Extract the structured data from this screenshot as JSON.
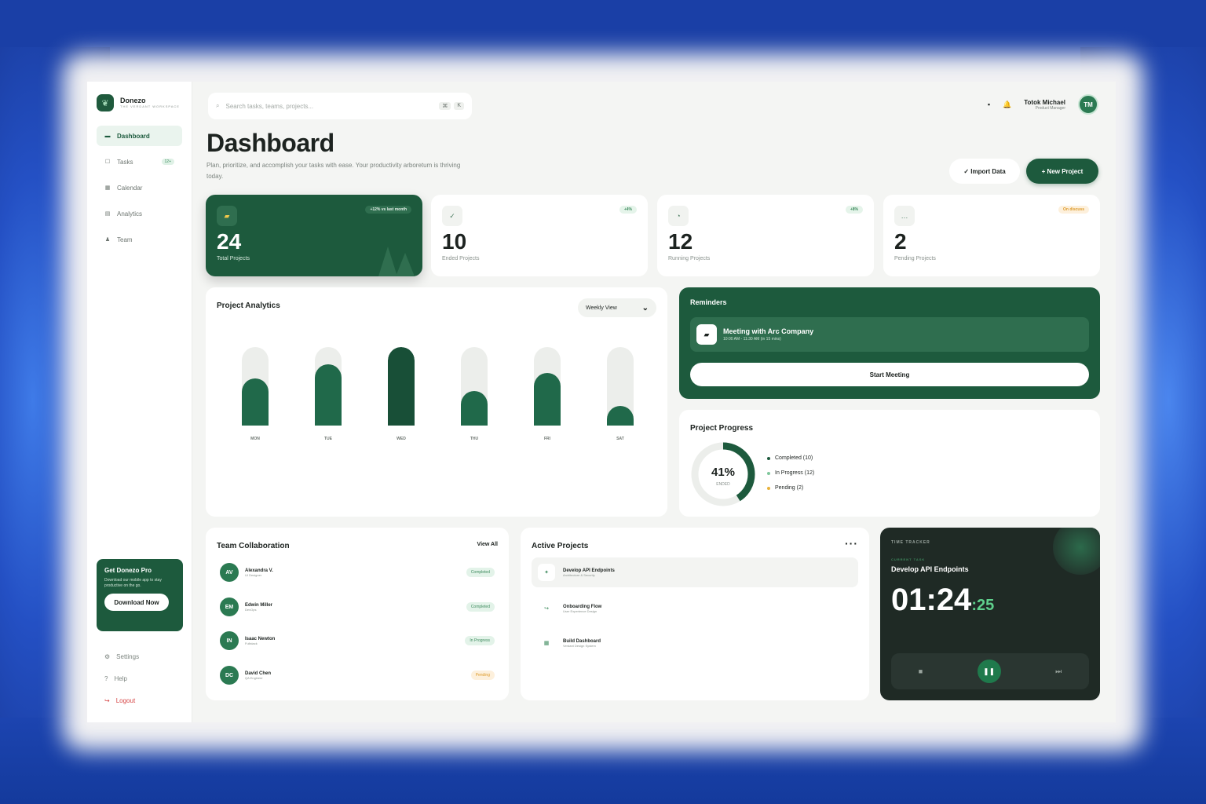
{
  "app": {
    "name": "Donezo",
    "subtitle": "THE VERDANT WORKSPACE"
  },
  "sidebar": {
    "items": [
      {
        "label": "Dashboard",
        "icon": "grid-icon",
        "glyph": "▬"
      },
      {
        "label": "Tasks",
        "icon": "task-icon",
        "glyph": "☐",
        "badge": "12+"
      },
      {
        "label": "Calendar",
        "icon": "calendar-icon",
        "glyph": "▦"
      },
      {
        "label": "Analytics",
        "icon": "analytics-icon",
        "glyph": "▤"
      },
      {
        "label": "Team",
        "icon": "team-icon",
        "glyph": "♟"
      }
    ],
    "promo": {
      "title": "Get Donezo Pro",
      "text": "Download our mobile app to stay productive on the go.",
      "button": "Download Now"
    },
    "footer": [
      {
        "label": "Settings",
        "glyph": "⚙"
      },
      {
        "label": "Help",
        "glyph": "?"
      },
      {
        "label": "Logout",
        "glyph": "↪"
      }
    ]
  },
  "header": {
    "search_placeholder": "Search tasks, teams, projects...",
    "shortcut": [
      "⌘",
      "K"
    ],
    "user": {
      "name": "Totok Michael",
      "role": "Product Manager",
      "initials": "TM"
    }
  },
  "page": {
    "title": "Dashboard",
    "description": "Plan, prioritize, and accomplish your tasks with ease. Your productivity arboretum is thriving today.",
    "import_button": "✓ Import Data",
    "new_button": "+ New Project"
  },
  "stats": [
    {
      "value": "24",
      "label": "Total Projects",
      "badge": "+12% vs last month",
      "glyph": "▰"
    },
    {
      "value": "10",
      "label": "Ended Projects",
      "badge": "+4%",
      "glyph": "✓"
    },
    {
      "value": "12",
      "label": "Running Projects",
      "badge": "+8%",
      "glyph": "◔"
    },
    {
      "value": "2",
      "label": "Pending Projects",
      "badge": "On discuss",
      "glyph": "…"
    }
  ],
  "analytics": {
    "title": "Project Analytics",
    "view": "Weekly View"
  },
  "chart_data": {
    "type": "bar",
    "categories": [
      "MON",
      "TUE",
      "WED",
      "THU",
      "FRI",
      "SAT"
    ],
    "values": [
      60,
      78,
      100,
      44,
      67,
      25
    ],
    "ylim": [
      0,
      100
    ]
  },
  "reminders": {
    "title": "Reminders",
    "meeting_title": "Meeting with Arc Company",
    "meeting_time": "10:00 AM - 11:30 AM (in 15 mins)",
    "button": "Start Meeting"
  },
  "progress": {
    "title": "Project Progress",
    "percent": 41,
    "percent_label": "41%",
    "caption": "ENDED",
    "legend": [
      {
        "label": "Completed (10)",
        "color": "#1d5a3d"
      },
      {
        "label": "In Progress (12)",
        "color": "#7fc79c"
      },
      {
        "label": "Pending (2)",
        "color": "#e9b23b"
      }
    ]
  },
  "team": {
    "title": "Team Collaboration",
    "view_all": "View All",
    "members": [
      {
        "initials": "AV",
        "name": "Alexandra V.",
        "role": "UI Designer",
        "status": "Completed",
        "tone": "green"
      },
      {
        "initials": "EM",
        "name": "Edwin Miller",
        "role": "DevOps",
        "status": "Completed",
        "tone": "green"
      },
      {
        "initials": "IN",
        "name": "Isaac Newton",
        "role": "Fullstack",
        "status": "In Progress",
        "tone": "green"
      },
      {
        "initials": "DC",
        "name": "David Chen",
        "role": "QA Engineer",
        "status": "Pending",
        "tone": "orange"
      }
    ]
  },
  "projects": {
    "title": "Active Projects",
    "items": [
      {
        "name": "Develop API Endpoints",
        "sub": "Architecture & Security",
        "glyph": "✦"
      },
      {
        "name": "Onboarding Flow",
        "sub": "User Experience Design",
        "glyph": "↪"
      },
      {
        "name": "Build Dashboard",
        "sub": "Verdant Design System",
        "glyph": "▦"
      }
    ]
  },
  "timer": {
    "heading": "TIME TRACKER",
    "sub": "CURRENT TASK",
    "task": "Develop API Endpoints",
    "clock": "01:24",
    "seconds": ":25"
  },
  "colors": {
    "brand": "#1d5a3d",
    "accent": "#5fd18d",
    "surface": "#f4f5f3",
    "backdrop": "#1a3fa6"
  }
}
